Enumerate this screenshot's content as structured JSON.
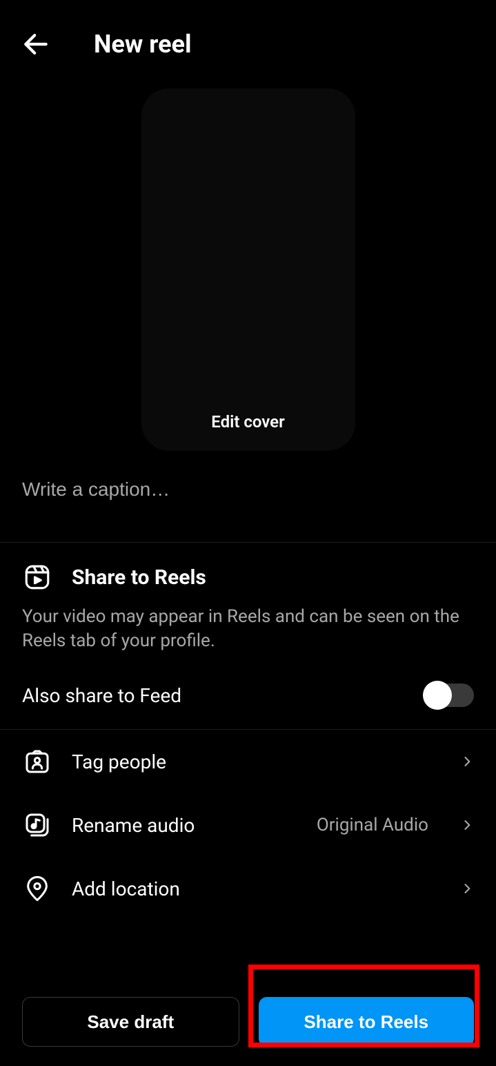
{
  "header": {
    "title": "New reel"
  },
  "cover": {
    "edit_label": "Edit cover"
  },
  "caption": {
    "placeholder": "Write a caption…"
  },
  "share_section": {
    "title": "Share to Reels",
    "description": "Your video may appear in Reels and can be seen on the Reels tab of your profile.",
    "feed_toggle_label": "Also share to Feed"
  },
  "rows": {
    "tag_people": "Tag people",
    "rename_audio": "Rename audio",
    "rename_audio_value": "Original Audio",
    "add_location": "Add location"
  },
  "footer": {
    "save_draft": "Save draft",
    "share": "Share to Reels"
  }
}
